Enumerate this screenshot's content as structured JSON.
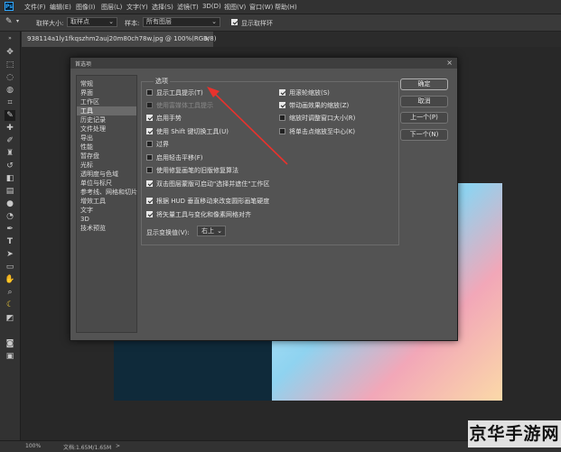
{
  "app": {
    "logo": "Ps"
  },
  "menubar": {
    "items": [
      "文件(F)",
      "编辑(E)",
      "图像(I)",
      "图层(L)",
      "文字(Y)",
      "选择(S)",
      "滤镜(T)",
      "3D(D)",
      "视图(V)",
      "窗口(W)",
      "帮助(H)"
    ]
  },
  "options_bar": {
    "sample_size_label": "取样大小:",
    "sample_size_value": "取样点",
    "sample_label": "样本:",
    "sample_value": "所有图层",
    "show_ring_label": "显示取样环",
    "show_ring_checked": true
  },
  "document_tab": {
    "title": "938114a1ly1fkqszhm2auj20m80ch78w.jpg @ 100%(RGB/8)",
    "close": "×"
  },
  "dialog": {
    "title": "首选项",
    "close": "×",
    "categories": [
      "常规",
      "界面",
      "工作区",
      "工具",
      "历史记录",
      "文件处理",
      "导出",
      "性能",
      "暂存盘",
      "光标",
      "透明度与色域",
      "单位与标尺",
      "参考线、网格和切片",
      "增效工具",
      "文字",
      "3D",
      "技术预览"
    ],
    "selected_category": "工具",
    "group_title": "选项",
    "left_options": [
      {
        "label": "显示工具提示(T)",
        "checked": false,
        "disabled": false
      },
      {
        "label": "使用富媒体工具提示",
        "checked": false,
        "disabled": true
      },
      {
        "label": "启用手势",
        "checked": true,
        "disabled": false
      },
      {
        "label": "使用 Shift 键切换工具(U)",
        "checked": true,
        "disabled": false
      },
      {
        "label": "过界",
        "checked": false,
        "disabled": false
      },
      {
        "label": "启用轻击平移(F)",
        "checked": false,
        "disabled": false
      },
      {
        "label": "使用修复画笔的旧版修复算法",
        "checked": false,
        "disabled": false
      },
      {
        "label": "双击图层蒙版可启动\"选择并遮住\"工作区",
        "checked": true,
        "disabled": false
      },
      {
        "label": "根据 HUD 垂直移动来改变圆形画笔硬度",
        "checked": true,
        "disabled": false
      },
      {
        "label": "将矢量工具与变化和像素网格对齐",
        "checked": true,
        "disabled": false
      }
    ],
    "right_options": [
      {
        "label": "用滚轮缩放(S)",
        "checked": true
      },
      {
        "label": "带动画效果的缩放(Z)",
        "checked": true
      },
      {
        "label": "缩放时调整窗口大小(R)",
        "checked": false
      },
      {
        "label": "将单击点缩放至中心(K)",
        "checked": false
      }
    ],
    "hud_label": "显示变换值(V):",
    "hud_value": "右上",
    "buttons": {
      "ok": "确定",
      "cancel": "取消",
      "prev": "上一个(P)",
      "next": "下一个(N)"
    }
  },
  "statusbar": {
    "zoom": "100%",
    "doc_info": "文档:1.65M/1.65M",
    "arrow": ">"
  },
  "watermark": "京华手游网",
  "colors": {
    "annotation_arrow": "#e8322d",
    "canvas_bg": "#282828",
    "dialog_bg": "#535353"
  }
}
